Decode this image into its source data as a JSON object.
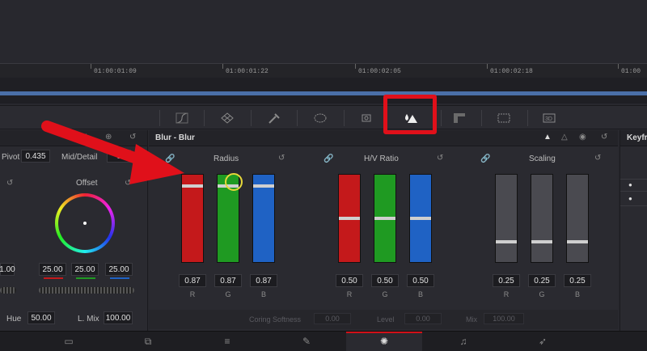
{
  "ruler": {
    "timecodes": [
      "01:00:01:09",
      "01:00:01:22",
      "01:00:02:05",
      "01:00:02:18",
      "01:00"
    ]
  },
  "toolbar": {
    "icons": [
      "curves-icon",
      "warper-icon",
      "qualifier-icon",
      "window-icon",
      "tracker-icon",
      "blur-icon",
      "key-icon",
      "sizing-icon",
      "3d-icon"
    ]
  },
  "left_panel": {
    "pivot_label": "Pivot",
    "pivot_value": "0.435",
    "mid_detail_label": "Mid/Detail",
    "mid_detail_value": "0",
    "offset_label": "Offset",
    "offset_values": [
      "1.00",
      "25.00",
      "25.00",
      "25.00"
    ],
    "hue_label": "Hue",
    "hue_value": "50.00",
    "lmix_label": "L. Mix",
    "lmix_value": "100.00"
  },
  "blur_panel": {
    "title": "Blur - Blur",
    "radius": {
      "label": "Radius",
      "values": [
        "0.87",
        "0.87",
        "0.87"
      ],
      "channels": [
        "R",
        "G",
        "B"
      ]
    },
    "hv_ratio": {
      "label": "H/V Ratio",
      "values": [
        "0.50",
        "0.50",
        "0.50"
      ],
      "channels": [
        "R",
        "G",
        "B"
      ]
    },
    "scaling": {
      "label": "Scaling",
      "values": [
        "0.25",
        "0.25",
        "0.25"
      ],
      "channels": [
        "R",
        "G",
        "B"
      ]
    },
    "coring_softness_label": "Coring Softness",
    "coring_softness_value": "0.00",
    "level_label": "Level",
    "level_value": "0.00",
    "mix_label": "Mix",
    "mix_value": "100.00"
  },
  "right_panel": {
    "title": "Keyfr"
  },
  "bottom_bar": {
    "icons": [
      "media-icon",
      "cut-icon",
      "edit-icon",
      "fusion-icon",
      "color-icon",
      "fairlight-icon",
      "deliver-icon"
    ]
  },
  "colors": {
    "highlight": "#e0101a",
    "arrow": "#e0101a",
    "red": "#c4191b",
    "green": "#1f9a22",
    "blue": "#1f62c4"
  }
}
